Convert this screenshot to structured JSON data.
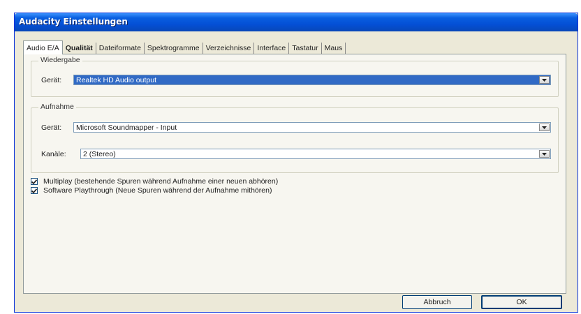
{
  "window": {
    "title": "Audacity Einstellungen"
  },
  "tabs": [
    {
      "label": "Audio E/A"
    },
    {
      "label": "Qualität"
    },
    {
      "label": "Dateiformate"
    },
    {
      "label": "Spektrogramme"
    },
    {
      "label": "Verzeichnisse"
    },
    {
      "label": "Interface"
    },
    {
      "label": "Tastatur"
    },
    {
      "label": "Maus"
    }
  ],
  "playback": {
    "group_title": "Wiedergabe",
    "device_label": "Gerät:",
    "device_value": "Realtek HD Audio output"
  },
  "recording": {
    "group_title": "Aufnahme",
    "device_label": "Gerät:",
    "device_value": "Microsoft Soundmapper - Input",
    "channels_label": "Kanäle:",
    "channels_value": "2 (Stereo)"
  },
  "options": [
    {
      "label": "Multiplay (bestehende Spuren während Aufnahme einer neuen abhören)",
      "checked": true
    },
    {
      "label": "Software Playthrough (Neue Spuren während der Aufnahme mithören)",
      "checked": true
    }
  ],
  "buttons": {
    "cancel": "Abbruch",
    "ok": "OK"
  },
  "colors": {
    "titlebar": "#0450d6",
    "selection": "#316ac5",
    "dialog": "#ece9d8"
  }
}
